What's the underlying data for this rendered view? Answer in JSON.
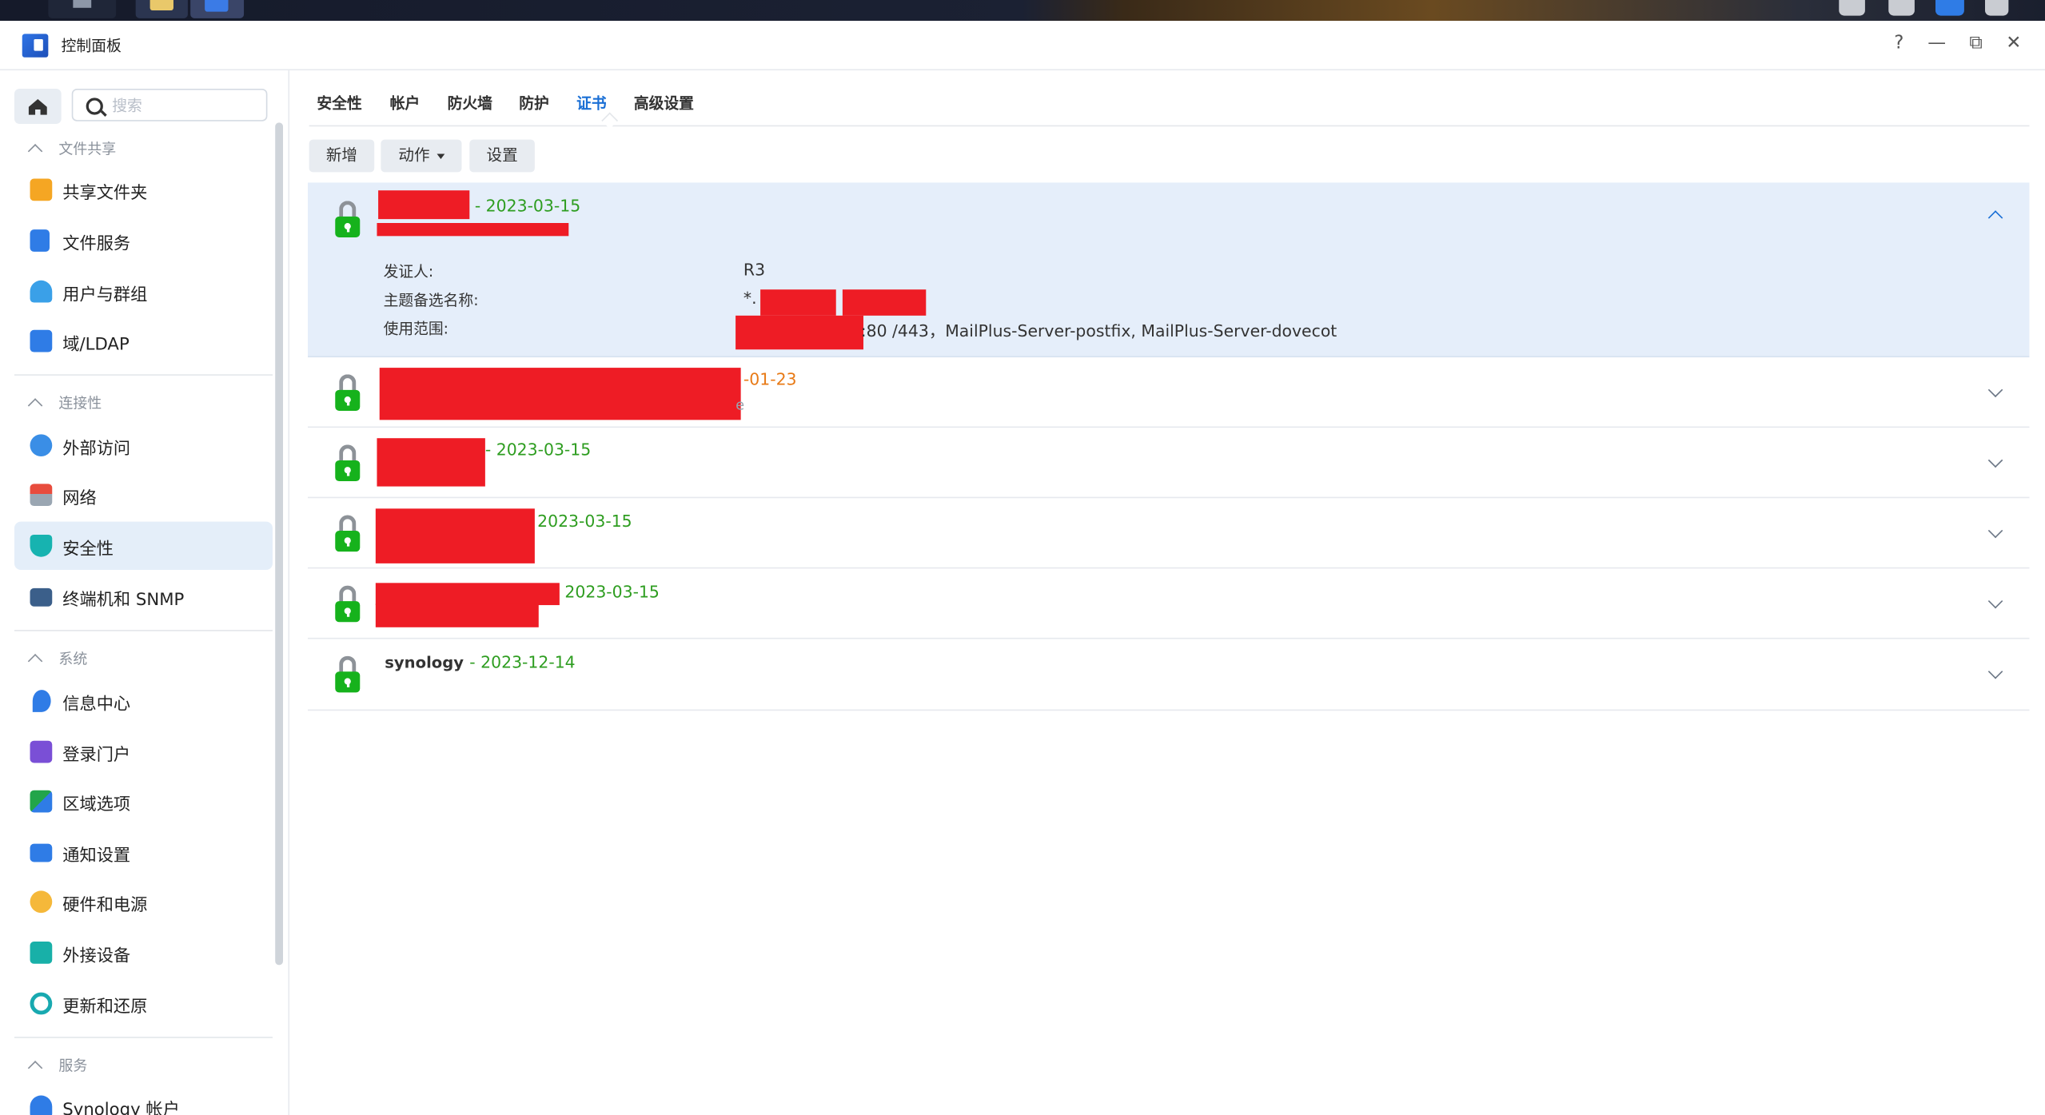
{
  "window": {
    "title": "控制面板",
    "controls": {
      "help": "?",
      "minimize": "—",
      "restore": "⧉",
      "close": "✕"
    }
  },
  "sidebar": {
    "search_placeholder": "搜索",
    "sections": [
      {
        "title": "文件共享",
        "items": [
          "共享文件夹",
          "文件服务",
          "用户与群组",
          "域/LDAP"
        ]
      },
      {
        "title": "连接性",
        "items": [
          "外部访问",
          "网络",
          "安全性",
          "终端机和 SNMP"
        ]
      },
      {
        "title": "系统",
        "items": [
          "信息中心",
          "登录门户",
          "区域选项",
          "通知设置",
          "硬件和电源",
          "外接设备",
          "更新和还原"
        ]
      },
      {
        "title": "服务",
        "items": [
          "Synology 帐户"
        ]
      }
    ],
    "active_item": "安全性"
  },
  "tabs": [
    "安全性",
    "帐户",
    "防火墙",
    "防护",
    "证书",
    "高级设置"
  ],
  "active_tab": "证书",
  "toolbar": {
    "add": "新增",
    "action": "动作",
    "settings": "设置"
  },
  "certificates": [
    {
      "date": "- 2023-03-15",
      "expanded": true,
      "details": {
        "issuer_label": "发证人:",
        "issuer": "R3",
        "san_label": "主题备选名称:",
        "san": "*.",
        "usage_label": "使用范围:",
        "usage": ":80 /443，MailPlus-Server-postfix, MailPlus-Server-dovecot"
      }
    },
    {
      "date": "-01-23",
      "date_color": "orange",
      "subtitle_tail": "e"
    },
    {
      "date": "- 2023-03-15"
    },
    {
      "date": "2023-03-15"
    },
    {
      "date": "2023-03-15"
    },
    {
      "name": "synology",
      "date": "- 2023-12-14"
    }
  ],
  "colors": {
    "accent": "#1a6fd5",
    "valid_green": "#2e9d20",
    "expiring_orange": "#e87a16",
    "lock_green": "#16b21c",
    "redaction_red": "#ee1c25"
  }
}
